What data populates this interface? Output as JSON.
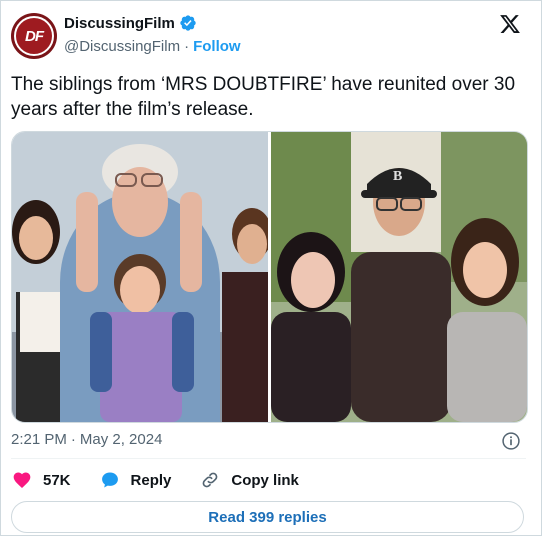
{
  "author": {
    "name": "DiscussingFilm",
    "handle": "@DiscussingFilm",
    "separator": "·",
    "follow_label": "Follow",
    "avatar_text": "DF",
    "verified_icon": "verified-badge-icon"
  },
  "platform_icon": "x-logo-icon",
  "tweet": {
    "text": "The siblings from ‘MRS DOUBTFIRE’ have reunited over 30 years after the film’s release."
  },
  "media": {
    "images": [
      {
        "name": "photo-left",
        "description_icon": "photo"
      },
      {
        "name": "photo-right",
        "description_icon": "photo"
      }
    ]
  },
  "meta": {
    "time": "2:21 PM",
    "separator": "·",
    "date": "May 2, 2024",
    "info_icon": "info-icon"
  },
  "actions": {
    "like_count": "57K",
    "reply_label": "Reply",
    "copy_label": "Copy link"
  },
  "read_replies_label": "Read 399 replies",
  "colors": {
    "accent": "#1d9bf0",
    "like": "#f91880",
    "avatar": "#9e1b20",
    "muted": "#536471"
  }
}
